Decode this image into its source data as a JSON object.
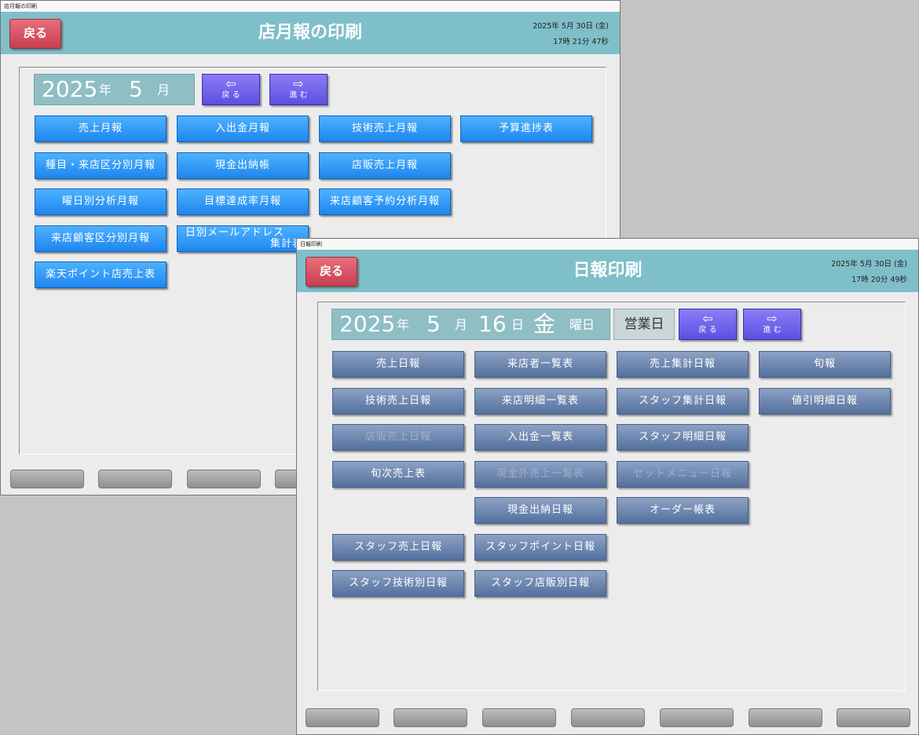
{
  "monthly_window": {
    "titlebar": "店月報の印刷",
    "back_label": "戻る",
    "title": "店月報の印刷",
    "date": "2025年 5月 30日 (金)",
    "time": "17時 21分 47秒",
    "period": {
      "year": "2025",
      "year_unit": "年",
      "month": "5",
      "month_unit": "月"
    },
    "nav": {
      "prev_arrow": "⇦",
      "prev_label": "戻 る",
      "next_arrow": "⇨",
      "next_label": "進 む"
    },
    "buttons": [
      "売上月報",
      "入出金月報",
      "技術売上月報",
      "予算進捗表",
      "種目・来店区分別月報",
      "現金出納帳",
      "店販売上月報",
      "曜日別分析月報",
      "目標達成率月報",
      "来店顧客予約分析月報",
      "来店顧客区分別月報",
      "日別メールアドレス",
      "集計表",
      "楽天ポイント店売上表"
    ]
  },
  "daily_window": {
    "titlebar": "日報印刷",
    "back_label": "戻る",
    "title": "日報印刷",
    "date": "2025年 5月 30日 (金)",
    "time": "17時 20分 49秒",
    "period": {
      "year": "2025",
      "year_unit": "年",
      "month": "5",
      "month_unit": "月",
      "day": "16",
      "day_unit": "日",
      "weekday": "金",
      "weekday_unit": "曜日"
    },
    "business_day": "営業日",
    "nav": {
      "prev_arrow": "⇦",
      "prev_label": "戻 る",
      "next_arrow": "⇨",
      "next_label": "進 む"
    },
    "buttons": [
      "売上日報",
      "来店者一覧表",
      "売上集計日報",
      "旬報",
      "技術売上日報",
      "来店明細一覧表",
      "スタッフ集計日報",
      "値引明細日報",
      "店販売上日報",
      "入出金一覧表",
      "スタッフ明細日報",
      "旬次売上表",
      "現金外売上一覧表",
      "セットメニュー日報",
      "現金出納日報",
      "オーダー帳表",
      "スタッフ売上日報",
      "スタッフポイント日報",
      "スタッフ技術別日報",
      "スタッフ店販別日報"
    ]
  }
}
